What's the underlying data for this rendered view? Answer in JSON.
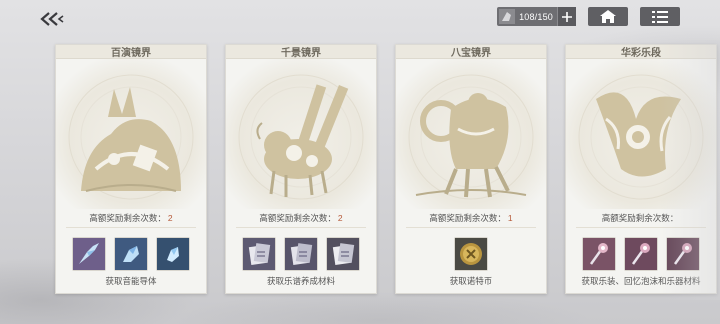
{
  "topbar": {
    "stamina_value": "108/150",
    "icons": [
      "back-arrow-icon",
      "stamina-icon",
      "plus-icon",
      "home-icon",
      "menu-list-icon"
    ]
  },
  "cards": [
    {
      "title": "百演镜界",
      "reward_label": "高额奖励剩余次数：",
      "reward_count": "2",
      "description": "获取音能导体",
      "item_icons": [
        "crystal-shard-icon",
        "crystal-shard-icon",
        "crystal-shard-icon"
      ]
    },
    {
      "title": "千景镜界",
      "reward_label": "高额奖励剩余次数：",
      "reward_count": "2",
      "description": "获取乐谱养成材料",
      "item_icons": [
        "score-box-icon",
        "score-box-icon",
        "score-box-icon"
      ]
    },
    {
      "title": "八宝镜界",
      "reward_label": "高额奖励剩余次数：",
      "reward_count": "1",
      "description": "获取诺特币",
      "item_icons": [
        "note-coin-icon"
      ]
    },
    {
      "title": "华彩乐段",
      "reward_label": "高额奖励剩余次数：",
      "reward_count": "",
      "description": "获取乐装、回忆泡沫和乐器材料",
      "item_icons": [
        "ornament-icon",
        "ornament-icon",
        "ornament-icon"
      ]
    }
  ],
  "colors": {
    "accent_count": "#b65a3a",
    "card_bg": "#f4f4f1",
    "art_gold": "#cfc2a0",
    "topbar_btn": "#5f5f63"
  }
}
